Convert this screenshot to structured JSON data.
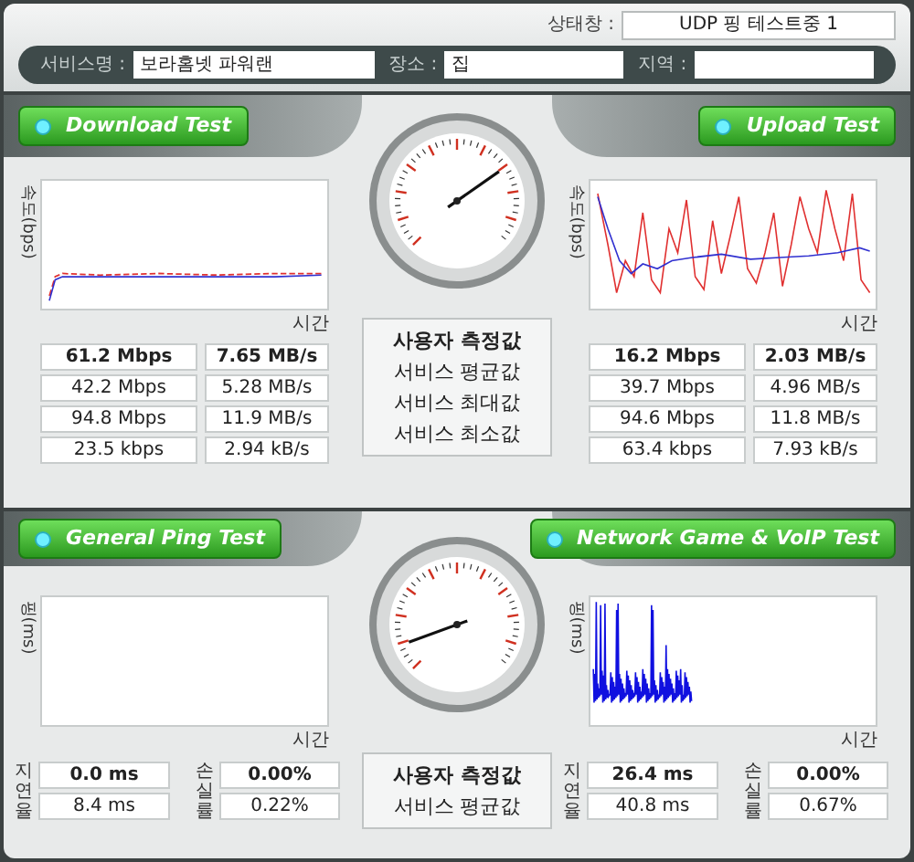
{
  "status": {
    "label": "상태창 :",
    "value": "UDP 핑 테스트중 1"
  },
  "info_fields": [
    {
      "label": "서비스명 :",
      "value": "보라홈넷 파워랜"
    },
    {
      "label": "장소 :",
      "value": "집"
    },
    {
      "label": "지역 :"
    }
  ],
  "speed": {
    "row_labels": [
      "사용자 측정값",
      "서비스 평균값",
      "서비스 최대값",
      "서비스 최소값"
    ],
    "panels": [
      {
        "kind": "download",
        "button": "Download Test",
        "ylabel": "속도(bps)",
        "xlabel": "시간",
        "rows": [
          [
            "61.2 Mbps",
            "7.65 MB/s"
          ],
          [
            "42.2 Mbps",
            "5.28 MB/s"
          ],
          [
            "94.8 Mbps",
            "11.9 MB/s"
          ],
          [
            "23.5 kbps",
            "2.94 kB/s"
          ]
        ]
      },
      {
        "kind": "upload",
        "button": "Upload Test",
        "ylabel": "속도(bps)",
        "xlabel": "시간",
        "rows": [
          [
            "16.2 Mbps",
            "2.03 MB/s"
          ],
          [
            "39.7 Mbps",
            "4.96 MB/s"
          ],
          [
            "94.6 Mbps",
            "11.8 MB/s"
          ],
          [
            "63.4 kbps",
            "7.93 kB/s"
          ]
        ]
      }
    ]
  },
  "ping": {
    "row_labels": [
      "사용자 측정값",
      "서비스 평균값"
    ],
    "panels": [
      {
        "kind": "general",
        "button": "General Ping Test",
        "ylabel": "핑(ms)",
        "xlabel": "시간",
        "delay_label": "지연율",
        "delay": [
          "0.0 ms",
          "8.4 ms"
        ],
        "loss_label": "손실률",
        "loss": [
          "0.00%",
          "0.22%"
        ]
      },
      {
        "kind": "game",
        "button": "Network Game & VoIP Test",
        "ylabel": "핑(ms)",
        "xlabel": "시간",
        "delay_label": "지연율",
        "delay": [
          "26.4 ms",
          "40.8 ms"
        ],
        "loss_label": "손실률",
        "loss": [
          "0.00%",
          "0.67%"
        ]
      }
    ]
  }
}
